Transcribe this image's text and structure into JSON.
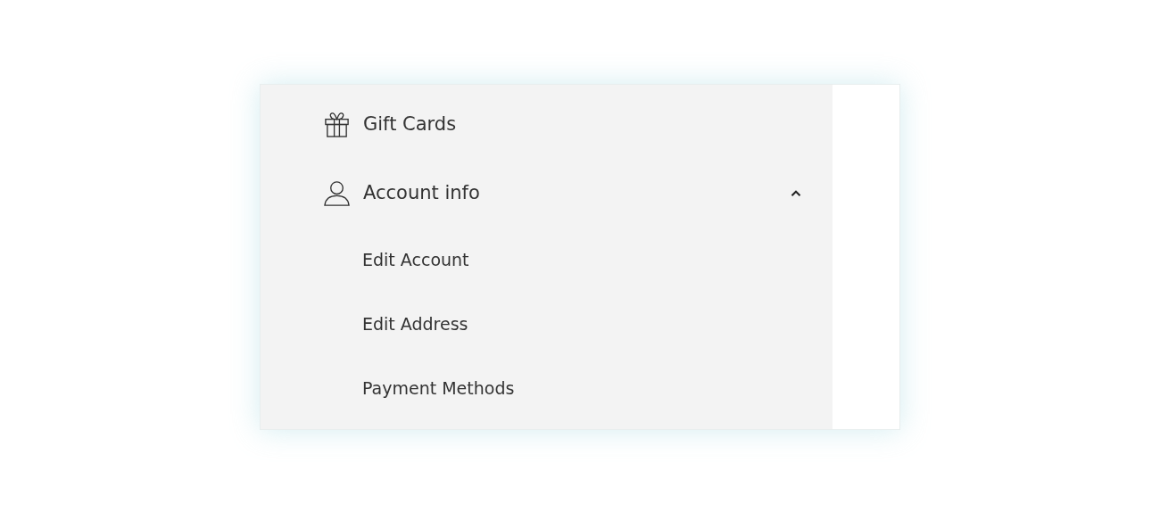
{
  "menu": [
    {
      "label": "Gift Cards"
    },
    {
      "label": "Account info",
      "expanded": true,
      "children": [
        {
          "label": "Edit Account"
        },
        {
          "label": "Edit Address"
        },
        {
          "label": "Payment Methods"
        }
      ]
    }
  ]
}
